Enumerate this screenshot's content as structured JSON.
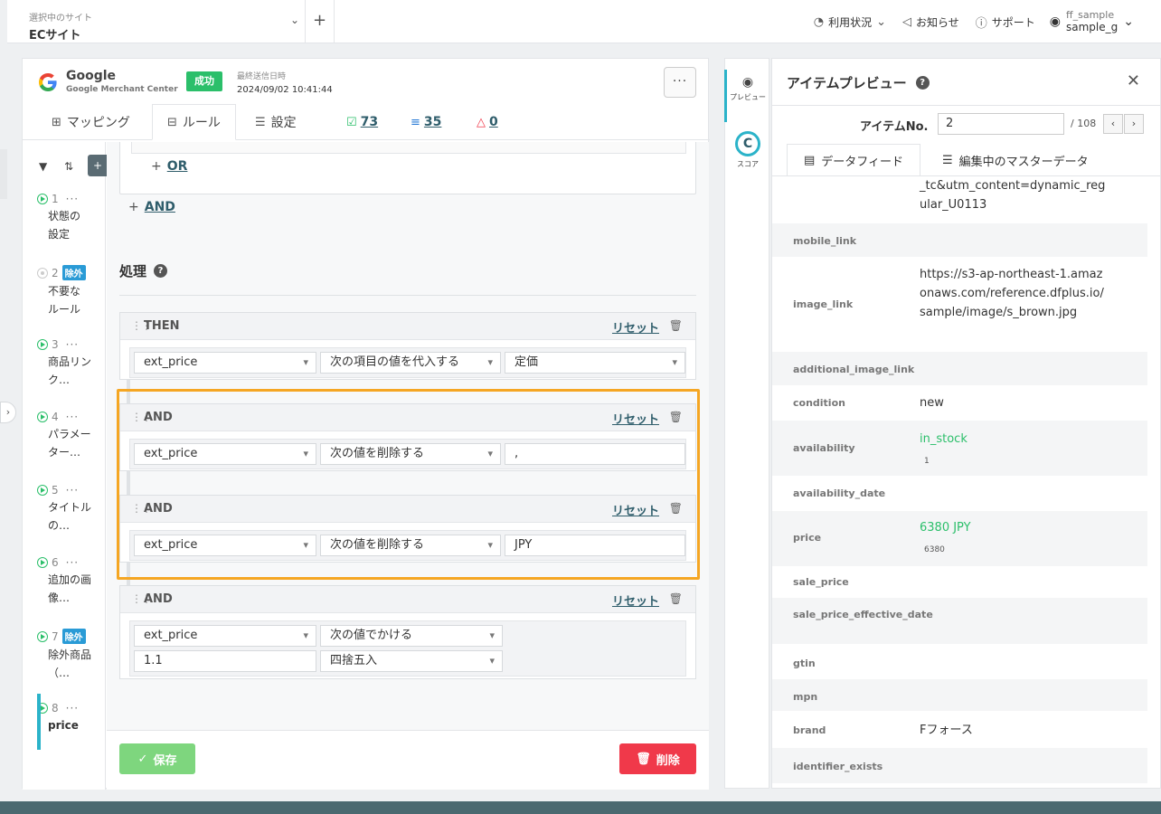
{
  "topbar": {
    "site_label": "選択中のサイト",
    "site_name": "ECサイト",
    "nav": [
      {
        "label": "利用状況",
        "icon": "gauge-icon"
      },
      {
        "label": "お知らせ",
        "icon": "megaphone-icon"
      },
      {
        "label": "サポート",
        "icon": "help-circle-icon"
      }
    ],
    "user_id": "ff_sample",
    "user_name": "sample_g"
  },
  "channel": {
    "name": "Google",
    "subtitle": "Google Merchant Center",
    "status": "成功",
    "last_sent_label": "最終送信日時",
    "last_sent": "2024/09/02 10:41:44"
  },
  "tabs": {
    "mapping": "マッピング",
    "rule": "ルール",
    "settings": "設定",
    "stat_ok": "73",
    "stat_fx": "35",
    "stat_warn": "0"
  },
  "rules": [
    {
      "num": "1",
      "title": "状態の設定",
      "badge": ""
    },
    {
      "num": "2",
      "title": "不要なルール",
      "badge": "除外"
    },
    {
      "num": "3",
      "title": "商品リンク…",
      "badge": ""
    },
    {
      "num": "4",
      "title": "パラメーター…",
      "badge": ""
    },
    {
      "num": "5",
      "title": "タイトルの…",
      "badge": ""
    },
    {
      "num": "6",
      "title": "追加の画像…",
      "badge": ""
    },
    {
      "num": "7",
      "title": "除外商品（…",
      "badge": "除外"
    },
    {
      "num": "8",
      "title": "price",
      "badge": ""
    }
  ],
  "editor": {
    "or_label": "OR",
    "and_label": "AND",
    "section_title": "処理",
    "reset_label": "リセット",
    "steps": [
      {
        "kind": "THEN",
        "field": "ext_price",
        "op": "次の項目の値を代入する",
        "value": "定価"
      },
      {
        "kind": "AND",
        "field": "ext_price",
        "op": "次の値を削除する",
        "value": ","
      },
      {
        "kind": "AND",
        "field": "ext_price",
        "op": "次の値を削除する",
        "value": "JPY"
      },
      {
        "kind": "AND",
        "field": "ext_price",
        "op": "次の値でかける",
        "value": "1.1",
        "rounding": "四捨五入"
      }
    ],
    "save_label": "保存",
    "delete_label": "削除"
  },
  "rail": {
    "preview_label": "プレビュー",
    "score_label": "スコア"
  },
  "preview": {
    "title": "アイテムプレビュー",
    "item_no_label": "アイテムNo.",
    "item_no": "2",
    "total": "/ 108",
    "tab_feed": "データフィード",
    "tab_master": "編集中のマスターデータ",
    "rows": [
      {
        "key": "",
        "value": "_tc&utm_content=dynamic_regular_U0113",
        "sub": ""
      },
      {
        "key": "mobile_link",
        "value": "",
        "sub": ""
      },
      {
        "key": "image_link",
        "value": "https://s3-ap-northeast-1.amazonaws.com/reference.dfplus.io/sample/image/s_brown.jpg",
        "sub": ""
      },
      {
        "key": "additional_image_link",
        "value": "",
        "sub": ""
      },
      {
        "key": "condition",
        "value": "new",
        "sub": ""
      },
      {
        "key": "availability",
        "value": "in_stock",
        "sub": "1"
      },
      {
        "key": "availability_date",
        "value": "",
        "sub": ""
      },
      {
        "key": "price",
        "value": "6380 JPY",
        "sub": "6380"
      },
      {
        "key": "sale_price",
        "value": "",
        "sub": ""
      },
      {
        "key": "sale_price_effective_date",
        "value": "",
        "sub": ""
      },
      {
        "key": "gtin",
        "value": "",
        "sub": ""
      },
      {
        "key": "mpn",
        "value": "",
        "sub": ""
      },
      {
        "key": "brand",
        "value": "Fフォース",
        "sub": ""
      },
      {
        "key": "identifier_exists",
        "value": "",
        "sub": ""
      }
    ]
  },
  "colors": {
    "accent": "#2bb3c9",
    "success": "#2bbf6a",
    "danger": "#f0394a",
    "highlight": "#f5a623"
  }
}
